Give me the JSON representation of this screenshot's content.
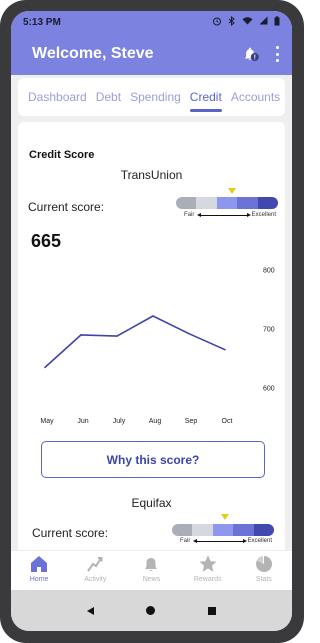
{
  "status_bar": {
    "time": "5:13 PM"
  },
  "header": {
    "title": "Welcome, Steve"
  },
  "tabs": [
    {
      "label": "Dashboard",
      "active": false
    },
    {
      "label": "Debt",
      "active": false
    },
    {
      "label": "Spending",
      "active": false
    },
    {
      "label": "Credit",
      "active": true
    },
    {
      "label": "Accounts",
      "active": false
    }
  ],
  "credit": {
    "section_title": "Credit Score",
    "transunion": {
      "bureau": "TransUnion",
      "current_label": "Current score:",
      "score": "665",
      "range_low": "Fair",
      "range_high": "Excellent"
    },
    "why_button": "Why this score?",
    "equifax": {
      "bureau": "Equifax",
      "current_label": "Current score:",
      "range_low": "Fair",
      "range_high": "Excellent"
    }
  },
  "score_bar_colors": [
    "#a9aeb8",
    "#d6d8e0",
    "#8f96ee",
    "#6b72d6",
    "#4148b0"
  ],
  "accent_color": "#5b63c9",
  "chart_data": {
    "type": "line",
    "categories": [
      "May",
      "Jun",
      "July",
      "Aug",
      "Sep",
      "Oct"
    ],
    "values": [
      635,
      690,
      688,
      722,
      692,
      665
    ],
    "yticks": [
      600,
      700,
      800
    ],
    "ylim": [
      590,
      810
    ],
    "color": "#3d45a8"
  },
  "bottom_nav": [
    {
      "label": "Home",
      "icon": "home-icon",
      "active": true
    },
    {
      "label": "Activity",
      "icon": "activity-icon",
      "active": false
    },
    {
      "label": "News",
      "icon": "news-bell-icon",
      "active": false
    },
    {
      "label": "Rewards",
      "icon": "star-icon",
      "active": false
    },
    {
      "label": "Stats",
      "icon": "pie-icon",
      "active": false
    }
  ]
}
